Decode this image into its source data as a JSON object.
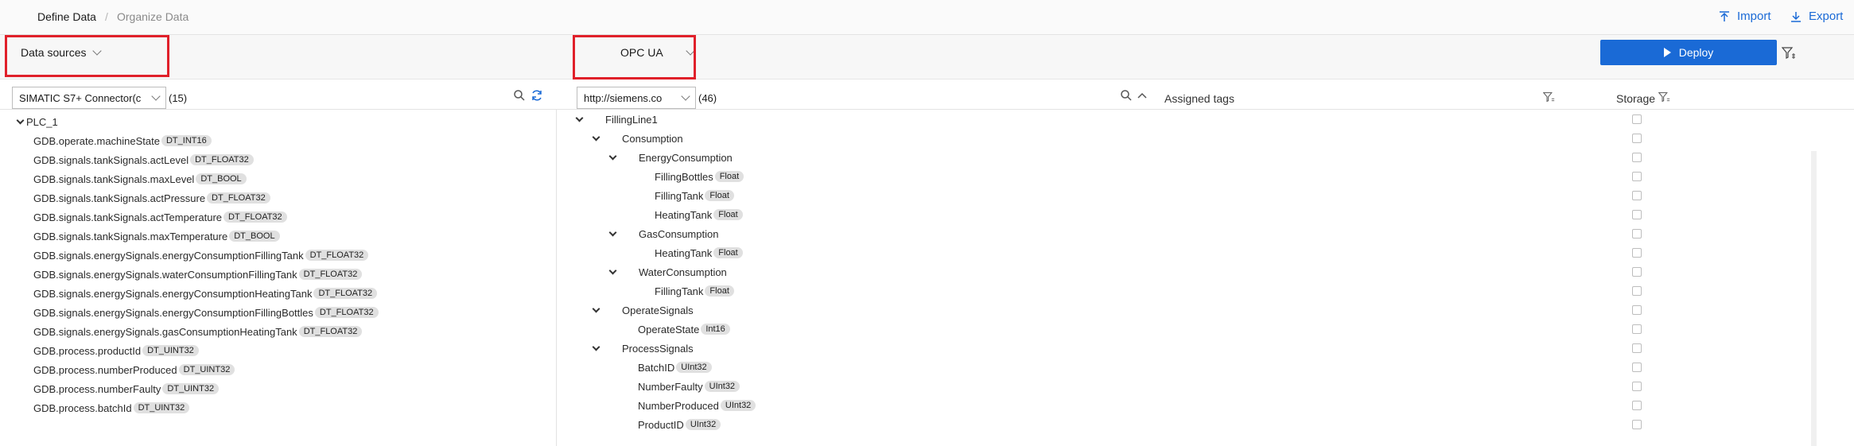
{
  "breadcrumb": {
    "define": "Define Data",
    "separator": "/",
    "organize": "Organize Data"
  },
  "actions": {
    "import": "Import",
    "export": "Export"
  },
  "left": {
    "source_dropdown": "Data sources",
    "connector_select": "SIMATIC S7+ Connector(c",
    "count": "(15)",
    "root": "PLC_1",
    "tags": [
      {
        "name": "GDB.operate.machineState",
        "type": "DT_INT16"
      },
      {
        "name": "GDB.signals.tankSignals.actLevel",
        "type": "DT_FLOAT32"
      },
      {
        "name": "GDB.signals.tankSignals.maxLevel",
        "type": "DT_BOOL"
      },
      {
        "name": "GDB.signals.tankSignals.actPressure",
        "type": "DT_FLOAT32"
      },
      {
        "name": "GDB.signals.tankSignals.actTemperature",
        "type": "DT_FLOAT32"
      },
      {
        "name": "GDB.signals.tankSignals.maxTemperature",
        "type": "DT_BOOL"
      },
      {
        "name": "GDB.signals.energySignals.energyConsumptionFillingTank",
        "type": "DT_FLOAT32"
      },
      {
        "name": "GDB.signals.energySignals.waterConsumptionFillingTank",
        "type": "DT_FLOAT32"
      },
      {
        "name": "GDB.signals.energySignals.energyConsumptionHeatingTank",
        "type": "DT_FLOAT32"
      },
      {
        "name": "GDB.signals.energySignals.energyConsumptionFillingBottles",
        "type": "DT_FLOAT32"
      },
      {
        "name": "GDB.signals.energySignals.gasConsumptionHeatingTank",
        "type": "DT_FLOAT32"
      },
      {
        "name": "GDB.process.productId",
        "type": "DT_UINT32"
      },
      {
        "name": "GDB.process.numberProduced",
        "type": "DT_UINT32"
      },
      {
        "name": "GDB.process.numberFaulty",
        "type": "DT_UINT32"
      },
      {
        "name": "GDB.process.batchId",
        "type": "DT_UINT32"
      }
    ]
  },
  "right": {
    "protocol_dropdown": "OPC UA",
    "deploy_label": "Deploy",
    "namespace_select": "http://siemens.co",
    "count": "(46)",
    "col_assigned": "Assigned tags",
    "col_storage": "Storage",
    "tree": [
      {
        "label": "FillingLine1",
        "kind": "node",
        "level": 0,
        "assigned": false
      },
      {
        "label": "Consumption",
        "kind": "node",
        "level": 1,
        "assigned": false
      },
      {
        "label": "EnergyConsumption",
        "kind": "node",
        "level": 2,
        "assigned": false
      },
      {
        "label": "FillingBottles",
        "type": "Float",
        "kind": "var",
        "level": 3,
        "assigned": true
      },
      {
        "label": "FillingTank",
        "type": "Float",
        "kind": "var",
        "level": 3,
        "assigned": true
      },
      {
        "label": "HeatingTank",
        "type": "Float",
        "kind": "var",
        "level": 3,
        "assigned": true
      },
      {
        "label": "GasConsumption",
        "kind": "node",
        "level": 2,
        "assigned": false
      },
      {
        "label": "HeatingTank",
        "type": "Float",
        "kind": "var",
        "level": 3,
        "assigned": true
      },
      {
        "label": "WaterConsumption",
        "kind": "node",
        "level": 2,
        "assigned": false
      },
      {
        "label": "FillingTank",
        "type": "Float",
        "kind": "var",
        "level": 3,
        "assigned": true
      },
      {
        "label": "OperateSignals",
        "kind": "node",
        "level": 1,
        "assigned": false
      },
      {
        "label": "OperateState",
        "type": "Int16",
        "kind": "var",
        "level": 2,
        "assigned": true
      },
      {
        "label": "ProcessSignals",
        "kind": "node",
        "level": 1,
        "assigned": false
      },
      {
        "label": "BatchID",
        "type": "UInt32",
        "kind": "var",
        "level": 2,
        "assigned": true
      },
      {
        "label": "NumberFaulty",
        "type": "UInt32",
        "kind": "var",
        "level": 2,
        "assigned": true
      },
      {
        "label": "NumberProduced",
        "type": "UInt32",
        "kind": "var",
        "level": 2,
        "assigned": true
      },
      {
        "label": "ProductID",
        "type": "UInt32",
        "kind": "var",
        "level": 2,
        "assigned": true
      }
    ]
  },
  "colors": {
    "accent": "#1a6ad6",
    "highlight": "#e0202a",
    "cube": "#3b6fd8"
  }
}
